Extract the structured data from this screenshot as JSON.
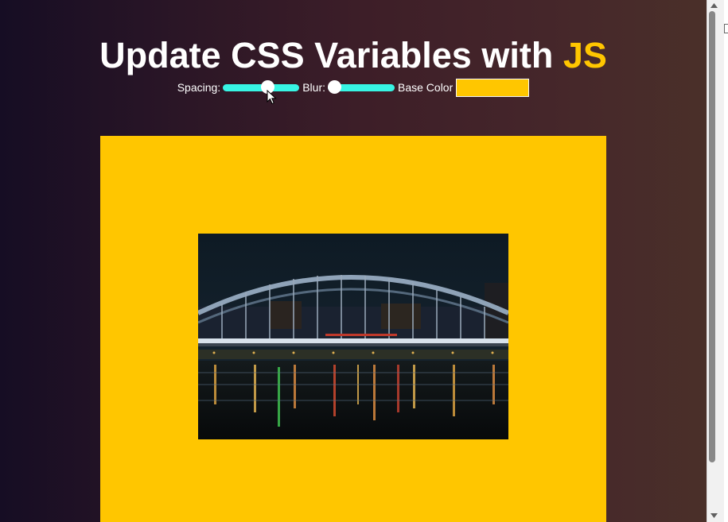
{
  "header": {
    "title_main": "Update CSS Variables with ",
    "title_highlight": "JS"
  },
  "controls": {
    "spacing_label": "Spacing:",
    "spacing_value": 0.6,
    "blur_label": "Blur:",
    "blur_value": 0.0,
    "base_color_label": "Base Color",
    "base_color": "#ffc600"
  },
  "colors": {
    "accent": "#ffc600",
    "slider_track": "#37f5e4",
    "background_start": "#160d24",
    "background_end": "#4b3129"
  },
  "image": {
    "subject": "night bridge over river"
  },
  "icons": {
    "cursor": "mouse-pointer-icon",
    "scroll_up": "chevron-up-icon",
    "scroll_down": "chevron-down-icon"
  }
}
